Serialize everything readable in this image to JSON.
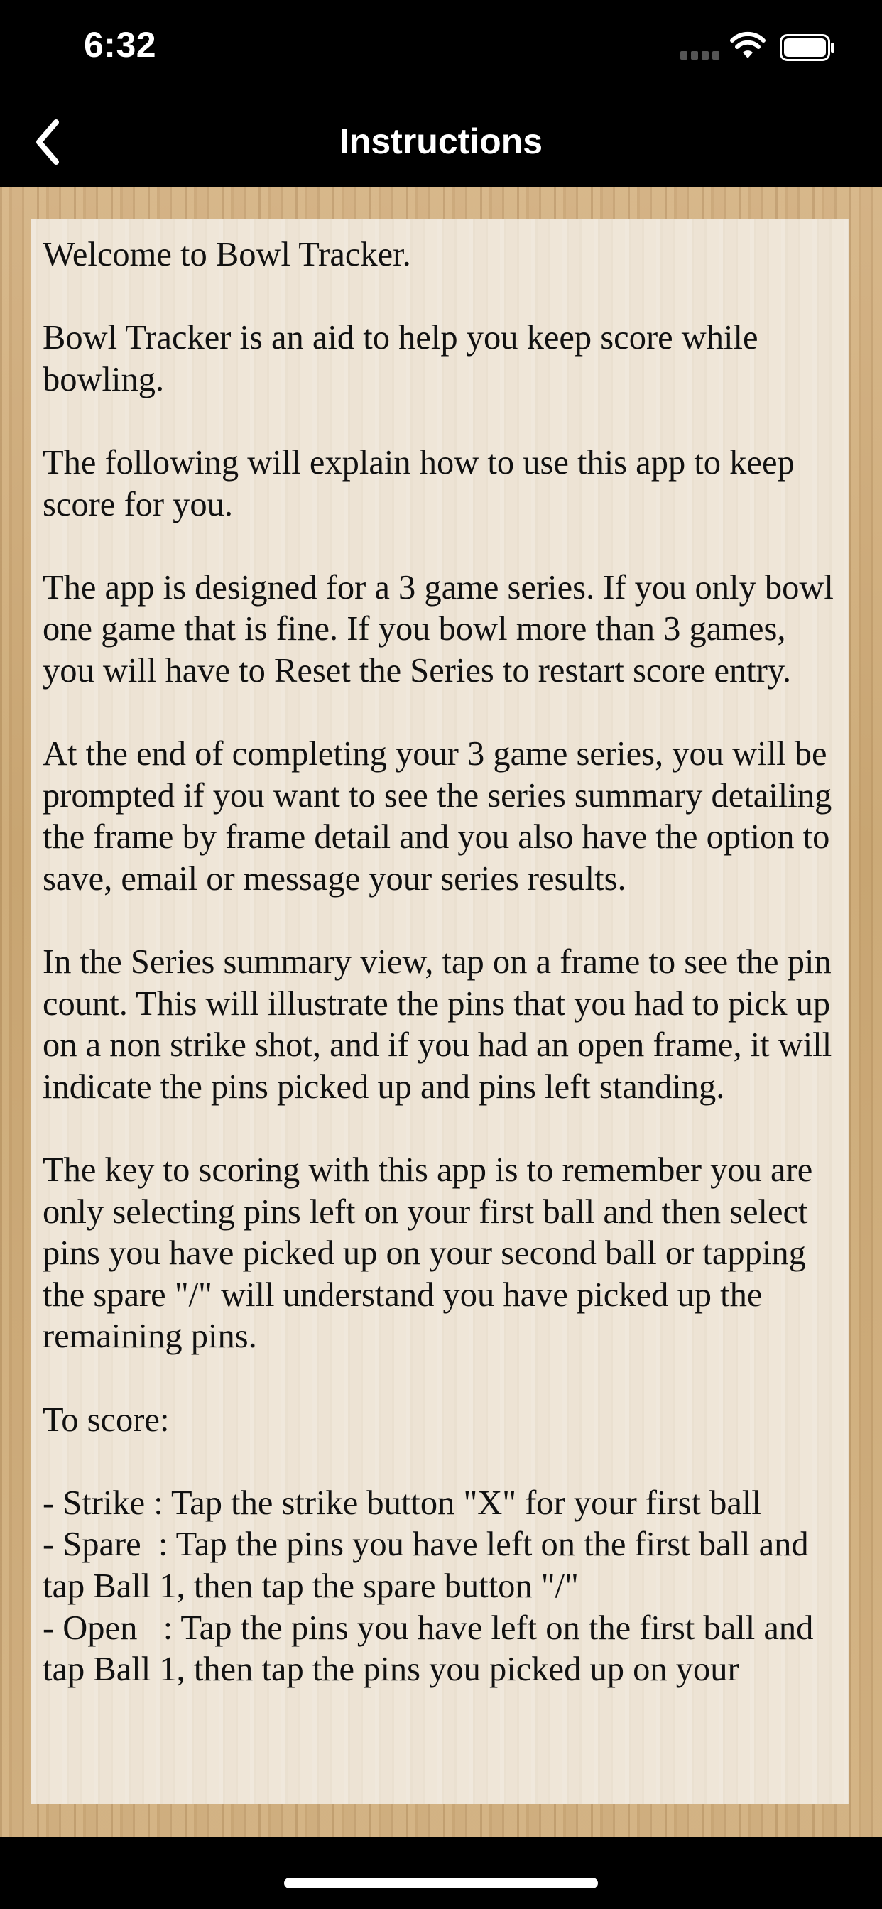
{
  "status_bar": {
    "time": "6:32"
  },
  "nav": {
    "title": "Instructions",
    "back_icon": "chevron-left-icon"
  },
  "instructions": {
    "text": "Welcome to Bowl Tracker.\n\nBowl Tracker is an aid to help you keep score while bowling.\n\nThe following will explain how to use this app to keep score for you.\n\nThe app is designed for a 3 game series. If you only bowl one game that is fine. If you bowl more than 3 games, you will have to Reset the Series to restart score entry.\n\nAt the end of completing your 3 game series, you will be prompted if you want to see the series summary detailing the frame by frame detail and you also have the option to save, email or message your series results.\n\nIn the Series summary view, tap on a frame to see the pin count. This will illustrate the pins that you had to pick up on a non strike shot, and if you had an open frame, it will indicate the pins picked up and pins left standing.\n\nThe key to scoring with this app is to remember you are only selecting pins left on your first ball and then select pins you have picked up on your second ball or tapping the spare \"/\" will understand you have picked up the remaining pins.\n\nTo score:\n\n- Strike : Tap the strike button \"X\" for your first ball\n- Spare  : Tap the pins you have left on the first ball and tap Ball 1, then tap the spare button \"/\"\n- Open   : Tap the pins you have left on the first ball and tap Ball 1, then tap the pins you picked up on your"
  },
  "colors": {
    "bar_background": "#000000",
    "panel_background": "#ede3d4",
    "wood": "#c9a876",
    "text": "#111111"
  }
}
